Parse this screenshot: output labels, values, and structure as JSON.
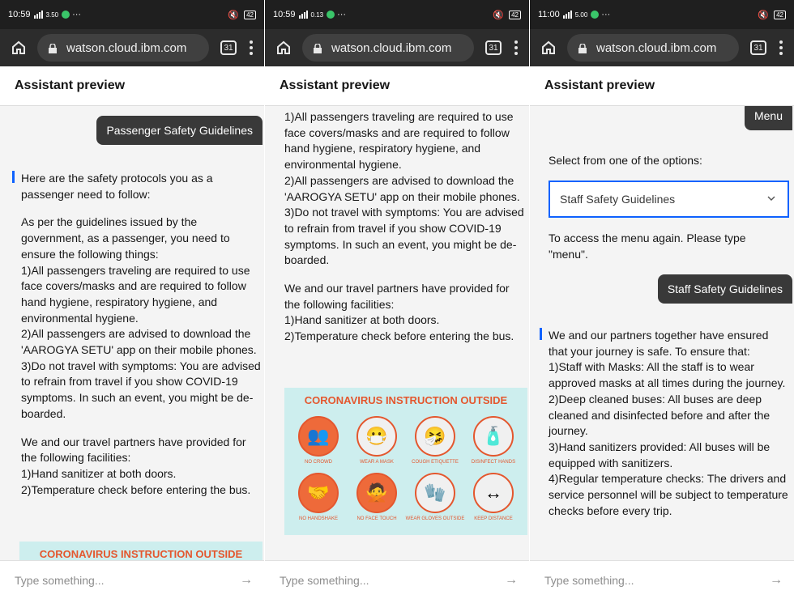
{
  "browser": {
    "url": "watson.cloud.ibm.com",
    "tab_count": "31"
  },
  "header": {
    "title": "Assistant preview"
  },
  "input": {
    "placeholder": "Type something...",
    "send_icon": "arrow-right-icon"
  },
  "panels": [
    {
      "status": {
        "time": "10:59",
        "speed": "3.50",
        "battery": "42"
      },
      "user_bubble": "Passenger Safety Guidelines",
      "bot_message": {
        "intro": "Here are the safety protocols you as a passenger need to follow:",
        "guidelines": "As per the guidelines issued by the government, as a passenger, you need to ensure the following things:\n1)All passengers traveling are required to use face covers/masks and are required to follow hand hygiene, respiratory hygiene, and environmental hygiene.\n2)All passengers are advised to download the 'AAROGYA SETU' app on their mobile phones.\n3)Do not travel with symptoms: You are advised to refrain from travel if you show COVID-19 symptoms. In such an event, you might be de-boarded.",
        "facilities": "We and our travel partners have provided for the following facilities:\n1)Hand sanitizer at both doors.\n2)Temperature check before entering the bus."
      },
      "infographic_title": "CORONAVIRUS INSTRUCTION OUTSIDE"
    },
    {
      "status": {
        "time": "10:59",
        "speed": "0.13",
        "battery": "42"
      },
      "bot_message": {
        "guidelines": "1)All passengers traveling are required to use face covers/masks and are required to follow hand hygiene, respiratory hygiene, and environmental hygiene.\n2)All passengers are advised to download the 'AAROGYA SETU' app on their mobile phones.\n3)Do not travel with symptoms: You are advised to refrain from travel if you show COVID-19 symptoms. In such an event, you might be de-boarded.",
        "facilities": "We and our travel partners have provided for the following facilities:\n1)Hand sanitizer at both doors.\n2)Temperature check before entering the bus."
      },
      "infographic": {
        "title": "CORONAVIRUS INSTRUCTION OUTSIDE",
        "items": [
          {
            "caption": "NO CROWD",
            "icon": "crowd-icon",
            "highlight": true
          },
          {
            "caption": "WEAR A MASK",
            "icon": "mask-icon",
            "highlight": false
          },
          {
            "caption": "COUGH ETIQUETTE",
            "icon": "cough-icon",
            "highlight": false
          },
          {
            "caption": "DISINFECT HANDS",
            "icon": "hand-sanitizer-icon",
            "highlight": false
          },
          {
            "caption": "NO HANDSHAKE",
            "icon": "handshake-icon",
            "highlight": true
          },
          {
            "caption": "NO FACE TOUCH",
            "icon": "face-touch-icon",
            "highlight": true
          },
          {
            "caption": "WEAR GLOVES OUTSIDE",
            "icon": "gloves-icon",
            "highlight": false
          },
          {
            "caption": "KEEP DISTANCE",
            "icon": "distance-icon",
            "highlight": false
          }
        ]
      }
    },
    {
      "status": {
        "time": "11:00",
        "speed": "5.00",
        "battery": "42"
      },
      "menu_bubble": "Menu",
      "select_prompt": "Select from one of the options:",
      "select_value": "Staff Safety Guidelines",
      "menu_hint": "To access the menu again. Please type \"menu\".",
      "user_bubble": "Staff Safety Guidelines",
      "bot_message": "We and our partners together have ensured that your journey is safe. To ensure that:\n1)Staff with Masks: All the staff is to wear approved masks at all times during the journey.\n2)Deep cleaned buses: All buses are deep cleaned and disinfected before and after the journey.\n3)Hand sanitizers provided: All buses will be equipped with sanitizers.\n4)Regular temperature checks: The drivers and service personnel will be subject to temperature checks before every trip."
    }
  ]
}
